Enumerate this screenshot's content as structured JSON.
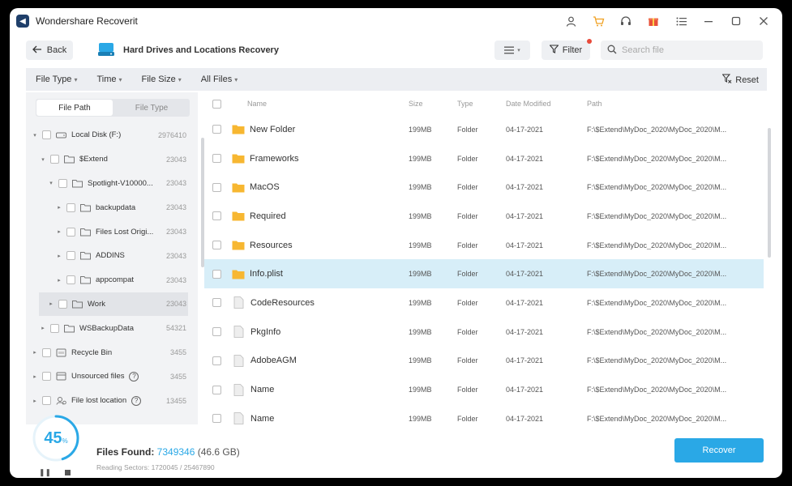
{
  "app": {
    "title": "Wondershare Recoverit"
  },
  "toolbar": {
    "back_label": "Back",
    "location_title": "Hard Drives and Locations Recovery",
    "filter_label": "Filter",
    "search_placeholder": "Search file"
  },
  "filters": {
    "file_type": "File Type",
    "time": "Time",
    "file_size": "File Size",
    "all_files": "All Files",
    "reset": "Reset"
  },
  "sidebar": {
    "tab_file_path": "File Path",
    "tab_file_type": "File Type",
    "tree": [
      {
        "label": "Local Disk (F:)",
        "count": "2976410",
        "icon": "disk-icon"
      },
      {
        "label": "$Extend",
        "count": "23043",
        "icon": "folder-icon"
      },
      {
        "label": "Spotlight-V10000...",
        "count": "23043",
        "icon": "folder-icon"
      },
      {
        "label": "backupdata",
        "count": "23043",
        "icon": "folder-icon"
      },
      {
        "label": "Files Lost Origi...",
        "count": "23043",
        "icon": "folder-icon"
      },
      {
        "label": "ADDINS",
        "count": "23043",
        "icon": "folder-icon"
      },
      {
        "label": "appcompat",
        "count": "23043",
        "icon": "folder-icon"
      },
      {
        "label": "Work",
        "count": "23043",
        "icon": "folder-icon"
      },
      {
        "label": "WSBackupData",
        "count": "54321",
        "icon": "folder-icon"
      },
      {
        "label": "Recycle Bin",
        "count": "3455",
        "icon": "recycle-bin-icon"
      },
      {
        "label": "Unsourced files",
        "count": "3455",
        "icon": "unsourced-icon"
      },
      {
        "label": "File lost location",
        "count": "13455",
        "icon": "user-location-icon"
      }
    ]
  },
  "table": {
    "headers": {
      "name": "Name",
      "size": "Size",
      "type": "Type",
      "date": "Date Modified",
      "path": "Path"
    },
    "rows": [
      {
        "name": "New Folder",
        "size": "199MB",
        "type": "Folder",
        "date": "04-17-2021",
        "path": "F:\\$Extend\\MyDoc_2020\\MyDoc_2020\\M..."
      },
      {
        "name": "Frameworks",
        "size": "199MB",
        "type": "Folder",
        "date": "04-17-2021",
        "path": "F:\\$Extend\\MyDoc_2020\\MyDoc_2020\\M..."
      },
      {
        "name": "MacOS",
        "size": "199MB",
        "type": "Folder",
        "date": "04-17-2021",
        "path": "F:\\$Extend\\MyDoc_2020\\MyDoc_2020\\M..."
      },
      {
        "name": "Required",
        "size": "199MB",
        "type": "Folder",
        "date": "04-17-2021",
        "path": "F:\\$Extend\\MyDoc_2020\\MyDoc_2020\\M..."
      },
      {
        "name": "Resources",
        "size": "199MB",
        "type": "Folder",
        "date": "04-17-2021",
        "path": "F:\\$Extend\\MyDoc_2020\\MyDoc_2020\\M..."
      },
      {
        "name": "Info.plist",
        "size": "199MB",
        "type": "Folder",
        "date": "04-17-2021",
        "path": "F:\\$Extend\\MyDoc_2020\\MyDoc_2020\\M..."
      },
      {
        "name": "CodeResources",
        "size": "199MB",
        "type": "Folder",
        "date": "04-17-2021",
        "path": "F:\\$Extend\\MyDoc_2020\\MyDoc_2020\\M..."
      },
      {
        "name": "PkgInfo",
        "size": "199MB",
        "type": "Folder",
        "date": "04-17-2021",
        "path": "F:\\$Extend\\MyDoc_2020\\MyDoc_2020\\M..."
      },
      {
        "name": "AdobeAGM",
        "size": "199MB",
        "type": "Folder",
        "date": "04-17-2021",
        "path": "F:\\$Extend\\MyDoc_2020\\MyDoc_2020\\M..."
      },
      {
        "name": "Name",
        "size": "199MB",
        "type": "Folder",
        "date": "04-17-2021",
        "path": "F:\\$Extend\\MyDoc_2020\\MyDoc_2020\\M..."
      },
      {
        "name": "Name",
        "size": "199MB",
        "type": "Folder",
        "date": "04-17-2021",
        "path": "F:\\$Extend\\MyDoc_2020\\MyDoc_2020\\M..."
      }
    ]
  },
  "footer": {
    "progress_percent": "45",
    "progress_sign": "%",
    "files_found_label": "Files Found:",
    "files_found_count": "7349346",
    "files_found_size": "(46.6 GB)",
    "reading_sectors": "Reading Sectors: 1720045 / 25467890",
    "recover_label": "Recover"
  },
  "colors": {
    "accent": "#2aa8e6",
    "selected_row": "#d7eef8",
    "folder": "#f7b731"
  }
}
